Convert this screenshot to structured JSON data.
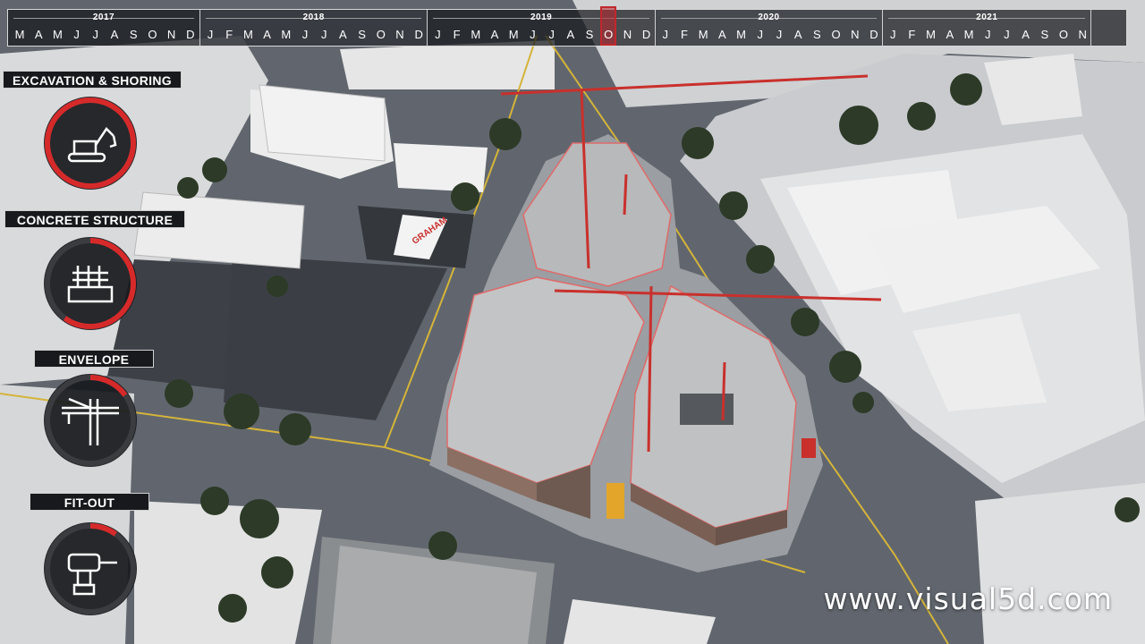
{
  "timeline": {
    "years": [
      {
        "label": "2017",
        "months": [
          "M",
          "A",
          "M",
          "J",
          "J",
          "A",
          "S",
          "O",
          "N",
          "D"
        ]
      },
      {
        "label": "2018",
        "months": [
          "J",
          "F",
          "M",
          "A",
          "M",
          "J",
          "J",
          "A",
          "S",
          "O",
          "N",
          "D"
        ]
      },
      {
        "label": "2019",
        "months": [
          "J",
          "F",
          "M",
          "A",
          "M",
          "J",
          "J",
          "A",
          "S",
          "O",
          "N",
          "D"
        ]
      },
      {
        "label": "2020",
        "months": [
          "J",
          "F",
          "M",
          "A",
          "M",
          "J",
          "J",
          "A",
          "S",
          "O",
          "N",
          "D"
        ]
      },
      {
        "label": "2021",
        "months": [
          "J",
          "F",
          "M",
          "A",
          "M",
          "J",
          "J",
          "A",
          "S",
          "O",
          "N"
        ]
      }
    ],
    "current": {
      "year": "2019",
      "month": "O"
    }
  },
  "phases": [
    {
      "label": "EXCAVATION & SHORING",
      "progress": 1.0,
      "icon": "excavator-icon"
    },
    {
      "label": "CONCRETE STRUCTURE",
      "progress": 0.6,
      "icon": "formwork-icon"
    },
    {
      "label": "ENVELOPE",
      "progress": 0.15,
      "icon": "tower-crane-icon"
    },
    {
      "label": "FIT-OUT",
      "progress": 0.1,
      "icon": "drill-icon"
    }
  ],
  "scene": {
    "site_sign": "GRAHAM"
  },
  "watermark": "www.visual5d.com",
  "colors": {
    "accent": "#d62a2a",
    "crane": "#c9302c",
    "panel": "#17191c"
  }
}
